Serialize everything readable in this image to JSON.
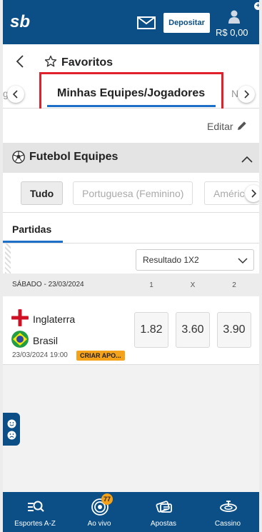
{
  "header": {
    "logo_text": "sb",
    "deposit_label": "Depositar",
    "balance": "R$ 0,00",
    "plus_badge": "+"
  },
  "favorites": {
    "title": "Favoritos"
  },
  "tabs": {
    "prev_partial": "gs",
    "active": "Minhas Equipes/Jogadores",
    "next_partial": "Nu"
  },
  "edit_label": "Editar",
  "section": {
    "title": "Futebol Equipes",
    "filters": [
      "Tudo",
      "Portuguesa (Feminino)",
      "Améric"
    ]
  },
  "subtab": "Partidas",
  "market": {
    "selected": "Resultado 1X2"
  },
  "event_group": {
    "date": "SÁBADO - 23/03/2024",
    "columns": [
      "1",
      "X",
      "2"
    ]
  },
  "match": {
    "home": "Inglaterra",
    "away": "Brasil",
    "time": "23/03/2024 19:00",
    "badge": "CRIAR APO...",
    "odds": [
      "1.82",
      "3.60",
      "3.90"
    ]
  },
  "bottom_nav": {
    "items": [
      {
        "label": "Esportes A-Z",
        "icon": "sports-search-icon"
      },
      {
        "label": "Ao vivo",
        "icon": "live-icon"
      },
      {
        "label": "Apostas",
        "icon": "bets-icon"
      },
      {
        "label": "Cassino",
        "icon": "casino-icon"
      }
    ],
    "live_count": "77"
  },
  "colors": {
    "brand": "#0b4f86",
    "accent": "#1e6fc7",
    "highlight": "#e0212c",
    "badge": "#f5a21b"
  }
}
